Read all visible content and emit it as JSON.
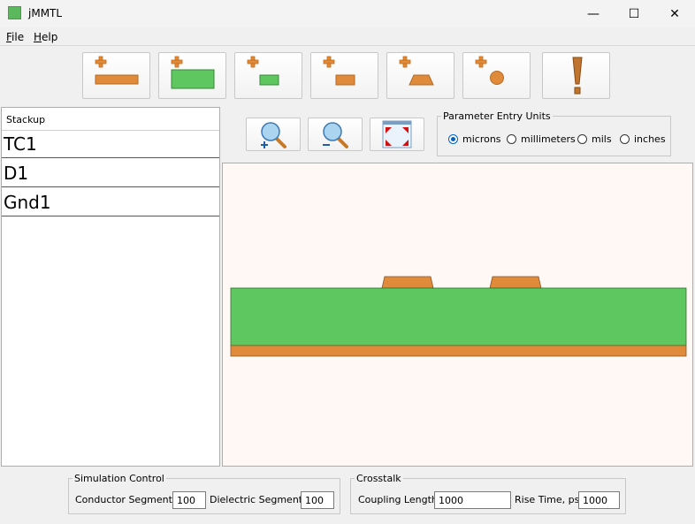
{
  "window": {
    "title": "jMMTL",
    "controls": {
      "minimize": "—",
      "maximize": "☐",
      "close": "✕"
    }
  },
  "menu": {
    "file": {
      "mnemonic": "F",
      "rest": "ile"
    },
    "help": {
      "mnemonic": "H",
      "rest": "elp"
    }
  },
  "toolbar": {
    "buttons": [
      {
        "icon": "add-ground-plane-icon"
      },
      {
        "icon": "add-dielectric-icon"
      },
      {
        "icon": "add-conductor-icon"
      },
      {
        "icon": "add-trapezoid-conductor-icon"
      },
      {
        "icon": "add-trapezoid-icon"
      },
      {
        "icon": "add-round-conductor-icon"
      },
      {
        "icon": "run-simulation-icon"
      }
    ]
  },
  "stackup": {
    "header": "Stackup",
    "items": [
      "TC1",
      "D1",
      "Gnd1"
    ]
  },
  "zoom": {
    "buttons": [
      {
        "icon": "zoom-in-icon"
      },
      {
        "icon": "zoom-out-icon"
      },
      {
        "icon": "fit-to-window-icon"
      }
    ]
  },
  "units": {
    "legend": "Parameter Entry Units",
    "options": [
      "microns",
      "millimeters",
      "mils",
      "inches"
    ],
    "selected": "microns"
  },
  "colors": {
    "conductor": "#e08a3c",
    "dielectric": "#5fc75f",
    "canvas_bg": "#fff8f5"
  },
  "simulation": {
    "legend": "Simulation Control",
    "conductor_label": "Conductor Segments:",
    "conductor_value": "100",
    "dielectric_label": "Dielectric Segments:",
    "dielectric_value": "100"
  },
  "crosstalk": {
    "legend": "Crosstalk",
    "coupling_label": "Coupling Length:",
    "coupling_value": "1000",
    "rise_label": "Rise Time, ps:",
    "rise_value": "1000"
  }
}
